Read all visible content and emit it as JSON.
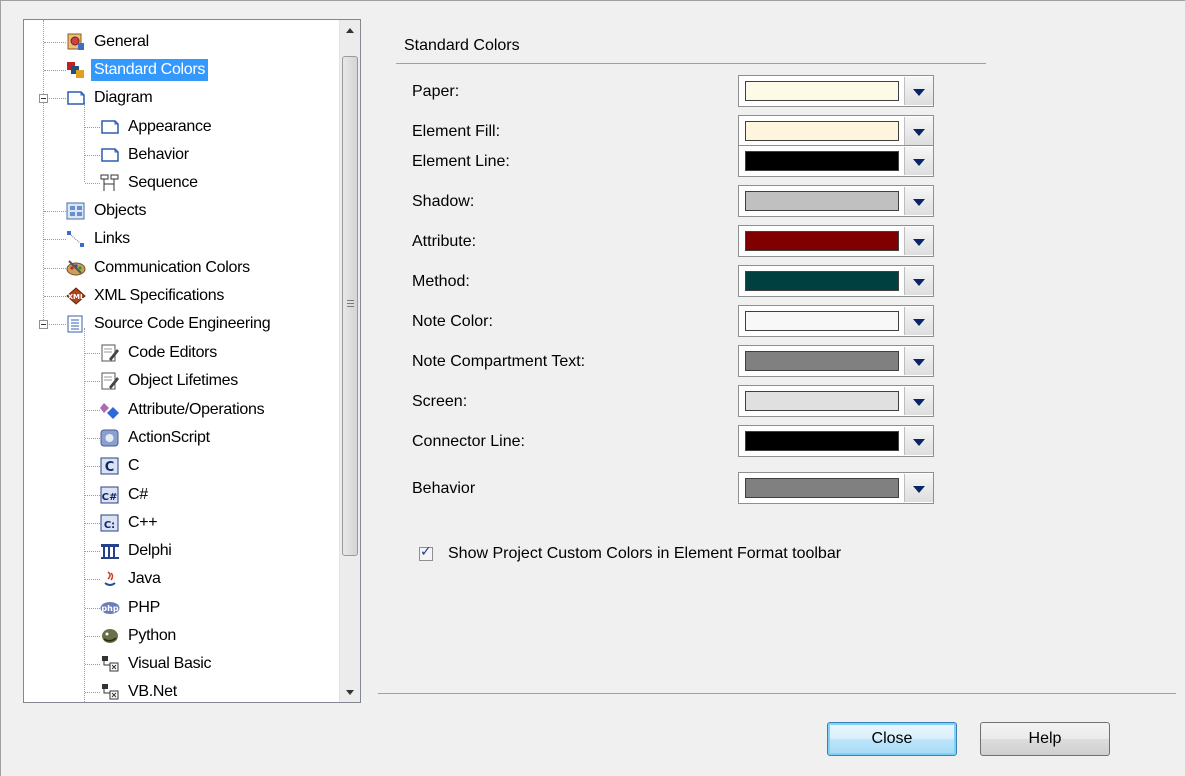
{
  "tree": {
    "items": [
      {
        "label": "General",
        "icon": "general-icon"
      },
      {
        "label": "Standard Colors",
        "icon": "standard-colors-icon",
        "selected": true
      },
      {
        "label": "Diagram",
        "icon": "diagram-icon",
        "expanded": true
      },
      {
        "label": "Appearance",
        "icon": "diagram-page-icon"
      },
      {
        "label": "Behavior",
        "icon": "diagram-page-icon"
      },
      {
        "label": "Sequence",
        "icon": "sequence-icon"
      },
      {
        "label": "Objects",
        "icon": "objects-icon"
      },
      {
        "label": "Links",
        "icon": "links-icon"
      },
      {
        "label": "Communication Colors",
        "icon": "palette-icon"
      },
      {
        "label": "XML Specifications",
        "icon": "xml-icon"
      },
      {
        "label": "Source Code Engineering",
        "icon": "source-code-icon",
        "expanded": true
      },
      {
        "label": "Code Editors",
        "icon": "editor-icon"
      },
      {
        "label": "Object Lifetimes",
        "icon": "editor-icon"
      },
      {
        "label": "Attribute/Operations",
        "icon": "attribute-operations-icon"
      },
      {
        "label": "ActionScript",
        "icon": "actionscript-icon"
      },
      {
        "label": "C",
        "icon": "c-lang-icon",
        "icon_text": "C"
      },
      {
        "label": "C#",
        "icon": "csharp-icon",
        "icon_text": "C#"
      },
      {
        "label": "C++",
        "icon": "cpp-icon",
        "icon_text": "C:"
      },
      {
        "label": "Delphi",
        "icon": "delphi-icon"
      },
      {
        "label": "Java",
        "icon": "java-icon"
      },
      {
        "label": "PHP",
        "icon": "php-icon",
        "icon_text": "php"
      },
      {
        "label": "Python",
        "icon": "python-icon"
      },
      {
        "label": "Visual Basic",
        "icon": "visual-basic-icon"
      },
      {
        "label": "VB.Net",
        "icon": "vbnet-icon"
      }
    ]
  },
  "panel": {
    "title": "Standard Colors",
    "rows": [
      {
        "label": "Paper:",
        "color": "#fdfbe8"
      },
      {
        "label": "Element Fill:",
        "color": "#fdf5dd"
      },
      {
        "label": "Element Line:",
        "color": "#000000"
      },
      {
        "label": "Shadow:",
        "color": "#c0c0c0"
      },
      {
        "label": "Attribute:",
        "color": "#800000"
      },
      {
        "label": "Method:",
        "color": "#004040"
      },
      {
        "label": "Note Color:",
        "color": "#f8f8f8"
      },
      {
        "label": "Note Compartment Text:",
        "color": "#808080"
      },
      {
        "label": "Screen:",
        "color": "#e0e0e0"
      },
      {
        "label": "Connector Line:",
        "color": "#000000"
      },
      {
        "label": "Behavior",
        "color": "#808080"
      }
    ],
    "checkbox": {
      "label": "Show Project Custom Colors in Element Format toolbar",
      "checked": true
    }
  },
  "buttons": {
    "close": "Close",
    "help": "Help"
  },
  "colors": {
    "selection": "#3399ff",
    "dropdown_arrow": "#0a246a"
  }
}
